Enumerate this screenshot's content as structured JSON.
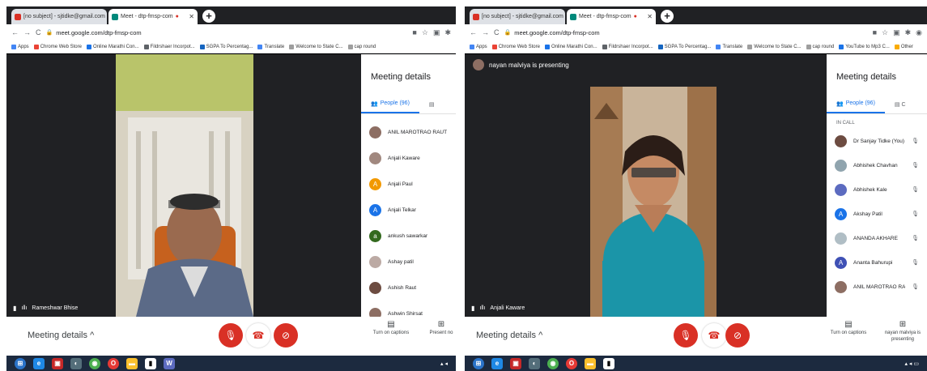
{
  "win1": {
    "tabs": [
      {
        "label": "[no subject] - sjtidke@gmail.com",
        "fav_color": "#d93025"
      },
      {
        "label": "Meet - dtp-fmsp-com",
        "fav_color": "#00897b"
      }
    ],
    "url": "meet.google.com/dtp-fmsp-com",
    "bookmarks": [
      {
        "label": "Apps",
        "color": "#4285f4"
      },
      {
        "label": "Chrome Web Store",
        "color": "#ea4335"
      },
      {
        "label": "Online Marathi Con...",
        "color": "#1a73e8"
      },
      {
        "label": "Fildrshaer Incorpot...",
        "color": "#5f6368"
      },
      {
        "label": "SGPA To Percentag...",
        "color": "#1565c0"
      },
      {
        "label": "Translate",
        "color": "#4285f4"
      },
      {
        "label": "Welcome to State C...",
        "color": "#9e9e9e"
      },
      {
        "label": "cap round",
        "color": "#9e9e9e"
      }
    ],
    "speaker_name": "Rameshwar Bhise",
    "panel": {
      "title": "Meeting details",
      "people_tab": "People (96)",
      "people": [
        {
          "name": "ANIL MAROTRAO RAUT",
          "color": "#8d6e63",
          "initial": ""
        },
        {
          "name": "Anjali Kaware",
          "color": "#a1887f",
          "initial": ""
        },
        {
          "name": "Anjali Paul",
          "color": "#f29900",
          "initial": "A"
        },
        {
          "name": "Anjali Telkar",
          "color": "#1a73e8",
          "initial": "A"
        },
        {
          "name": "ankush sawarkar",
          "color": "#33691e",
          "initial": "a"
        },
        {
          "name": "Ashay patil",
          "color": "#bcaaa4",
          "initial": ""
        },
        {
          "name": "Ashish Raut",
          "color": "#6d4c41",
          "initial": ""
        },
        {
          "name": "Ashwin Shirsat",
          "color": "#8d6e63",
          "initial": ""
        }
      ]
    },
    "bottom": {
      "meeting_details": "Meeting details",
      "captions": "Turn on captions",
      "present": "Present no"
    }
  },
  "win2": {
    "tabs": [
      {
        "label": "[no subject] - sjtidke@gmail.com",
        "fav_color": "#d93025"
      },
      {
        "label": "Meet - dtp-fmsp-com",
        "fav_color": "#00897b"
      }
    ],
    "url": "meet.google.com/dtp-fmsp-com",
    "bookmarks": [
      {
        "label": "Apps",
        "color": "#4285f4"
      },
      {
        "label": "Chrome Web Store",
        "color": "#ea4335"
      },
      {
        "label": "Online Marathi Con...",
        "color": "#1a73e8"
      },
      {
        "label": "Fildrshaer Incorpot...",
        "color": "#5f6368"
      },
      {
        "label": "SGPA To Percentag...",
        "color": "#1565c0"
      },
      {
        "label": "Translate",
        "color": "#4285f4"
      },
      {
        "label": "Welcome to State C...",
        "color": "#9e9e9e"
      },
      {
        "label": "cap round",
        "color": "#9e9e9e"
      },
      {
        "label": "YouTube to Mp3 C...",
        "color": "#1a73e8"
      },
      {
        "label": "Other",
        "color": "#f9ab00"
      }
    ],
    "presenting_banner": "nayan malviya is presenting",
    "speaker_name": "Anjali Kaware",
    "panel": {
      "title": "Meeting details",
      "people_tab": "People (96)",
      "in_call": "IN CALL",
      "people": [
        {
          "name": "Dr Sanjay Tidke (You)",
          "color": "#6d4c41",
          "initial": ""
        },
        {
          "name": "Abhishek Chavhan",
          "color": "#90a4ae",
          "initial": ""
        },
        {
          "name": "Abhishek Kale",
          "color": "#5c6bc0",
          "initial": ""
        },
        {
          "name": "Akshay Patil",
          "color": "#1a73e8",
          "initial": "A"
        },
        {
          "name": "ANANDA AKHARE",
          "color": "#b0bec5",
          "initial": ""
        },
        {
          "name": "Ananta Bahurupi",
          "color": "#3f51b5",
          "initial": "A"
        },
        {
          "name": "ANIL MAROTRAO RAUT",
          "color": "#8d6e63",
          "initial": ""
        }
      ]
    },
    "bottom": {
      "meeting_details": "Meeting details",
      "captions": "Turn on captions",
      "presenting": "nayan malviya is presenting"
    }
  }
}
